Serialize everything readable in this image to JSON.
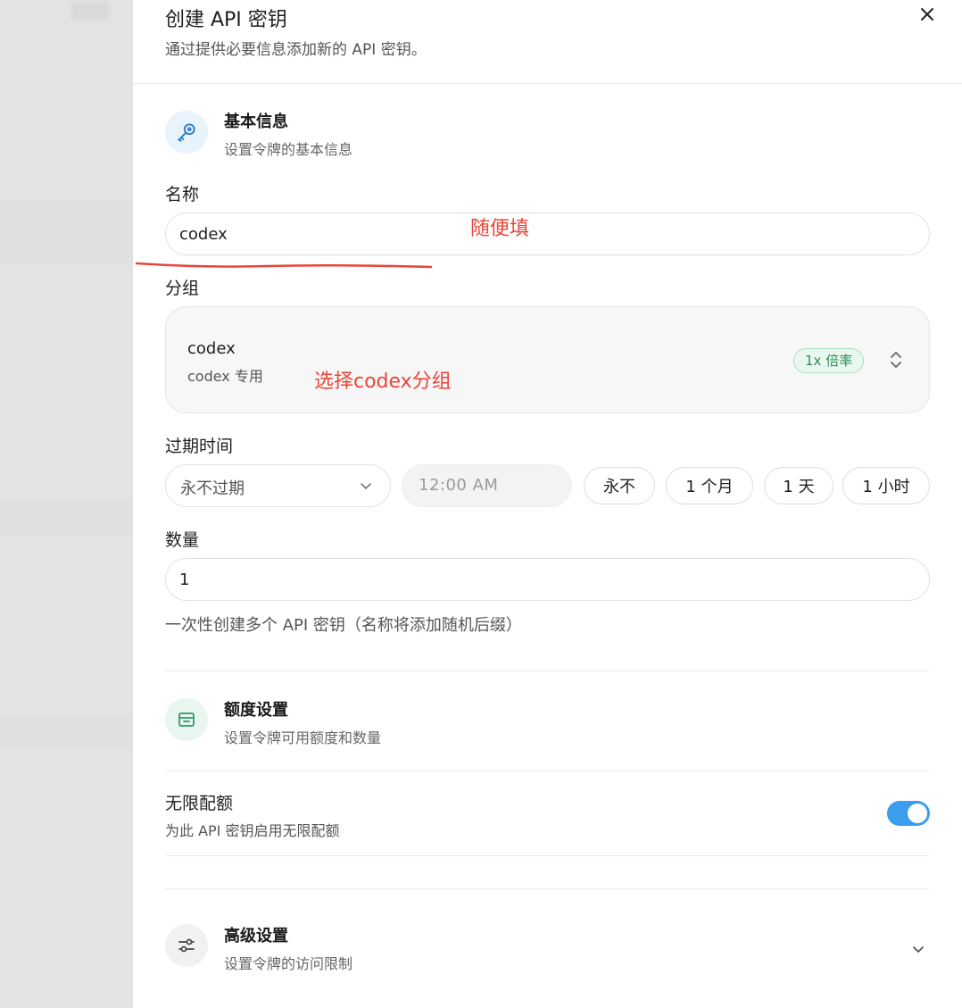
{
  "dialog": {
    "title": "创建 API 密钥",
    "subtitle": "通过提供必要信息添加新的 API 密钥。"
  },
  "basic": {
    "title": "基本信息",
    "subtitle": "设置令牌的基本信息",
    "icon": "key-icon",
    "icon_bg": "#e9f3fb",
    "icon_color": "#2f7fc7"
  },
  "name_field": {
    "label": "名称",
    "value": "codex"
  },
  "group_field": {
    "label": "分组",
    "selected_name": "codex",
    "selected_desc": "codex 专用",
    "rate_badge": "1x 倍率"
  },
  "expiry": {
    "label": "过期时间",
    "select_value": "永不过期",
    "time_value": "12:00 AM",
    "quick_options": [
      "永不",
      "1 个月",
      "1 天",
      "1 小时"
    ]
  },
  "quantity": {
    "label": "数量",
    "value": "1",
    "hint": "一次性创建多个 API 密钥（名称将添加随机后缀）"
  },
  "quota": {
    "title": "额度设置",
    "subtitle": "设置令牌可用额度和数量",
    "icon": "wallet-icon",
    "icon_bg": "#e9f6ef",
    "icon_color": "#2e9a63",
    "unlimited_label": "无限配额",
    "unlimited_desc": "为此 API 密钥启用无限配额",
    "unlimited_on": true,
    "toggle_color": "#3b9ded"
  },
  "advanced": {
    "title": "高级设置",
    "subtitle": "设置令牌的访问限制",
    "icon": "sliders-icon",
    "icon_bg": "#f1f1f1",
    "icon_color": "#444444"
  },
  "annotations": {
    "name_note": "随便填",
    "group_note": "选择codex分组",
    "color": "#e8463a"
  }
}
